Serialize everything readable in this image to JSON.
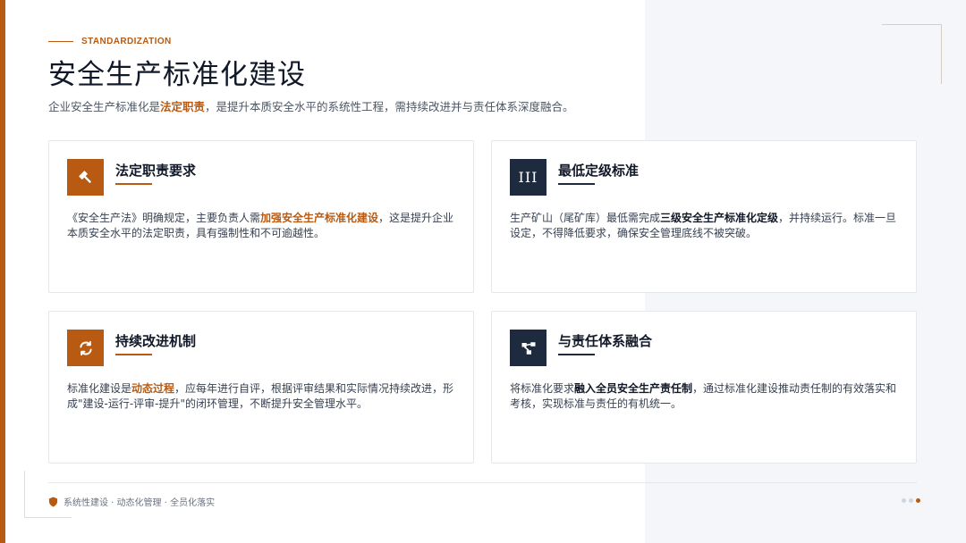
{
  "header": {
    "eyebrow": "STANDARDIZATION",
    "title": "安全生产标准化建设",
    "subtitle_pre": "企业安全生产标准化是",
    "subtitle_highlight": "法定职责",
    "subtitle_post": "，是提升本质安全水平的系统性工程，需持续改进并与责任体系深度融合。"
  },
  "cards": [
    {
      "icon": "gavel-icon",
      "title": "法定职责要求",
      "body_pre": "《安全生产法》明确规定，主要负责人需",
      "body_highlight": "加强安全生产标准化建设",
      "body_post": "，这是提升企业本质安全水平的法定职责，具有强制性和不可逾越性。"
    },
    {
      "icon": "roman-three-icon",
      "icon_text": "III",
      "title": "最低定级标准",
      "body_pre": "生产矿山（尾矿库）最低需完成",
      "body_highlight": "三级安全生产标准化定级",
      "body_post": "，并持续运行。标准一旦设定，不得降低要求，确保安全管理底线不被突破。"
    },
    {
      "icon": "refresh-icon",
      "title": "持续改进机制",
      "body_pre": "标准化建设是",
      "body_highlight": "动态过程",
      "body_post": "，应每年进行自评，根据评审结果和实际情况持续改进，形成\"建设-运行-评审-提升\"的闭环管理，不断提升安全管理水平。"
    },
    {
      "icon": "sitemap-icon",
      "title": "与责任体系融合",
      "body_pre": "将标准化要求",
      "body_highlight": "融入全员安全生产责任制",
      "body_post": "，通过标准化建设推动责任制的有效落实和考核，实现标准与责任的有机统一。"
    }
  ],
  "footer": {
    "icon": "shield-icon",
    "text": "系统性建设 · 动态化管理 · 全员化落实"
  },
  "pagination": {
    "total": 3,
    "active_index": 2
  },
  "colors": {
    "accent": "#b85a12",
    "navy": "#1e2a3d"
  }
}
